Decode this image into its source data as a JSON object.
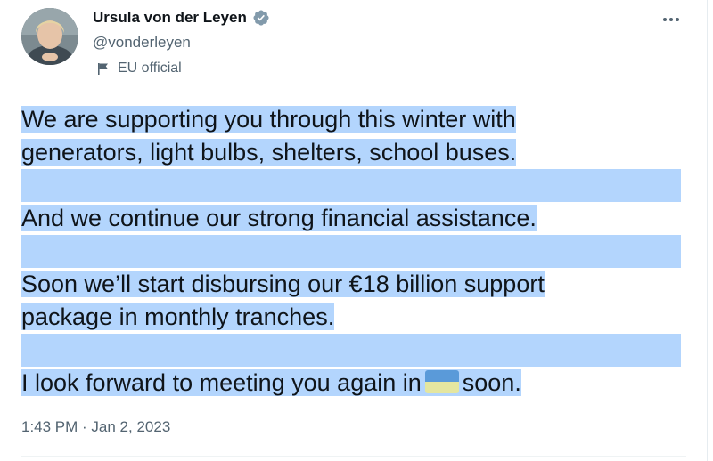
{
  "author": {
    "display_name": "Ursula von der Leyen",
    "handle": "@vonderleyen",
    "label": "EU official",
    "avatar_icon": "profile-photo",
    "verified_icon": "verified-badge-icon"
  },
  "tweet": {
    "paragraphs": [
      [
        "We are supporting you through this winter with",
        "generators, light bulbs, shelters, school buses."
      ],
      [
        "And we continue our strong financial assistance."
      ],
      [
        "Soon we’ll start disbursing our €18 billion support",
        "package in monthly tranches."
      ]
    ],
    "last_line_before": "I look forward to meeting you again in",
    "last_line_after": "soon.",
    "flag_emoji_icon": "ukraine-flag-emoji",
    "timestamp": "1:43 PM · Jan 2, 2023"
  },
  "colors": {
    "selection_highlight": "#b3d5fd",
    "verified_badge": "#829aab",
    "secondary_text": "#536471"
  }
}
